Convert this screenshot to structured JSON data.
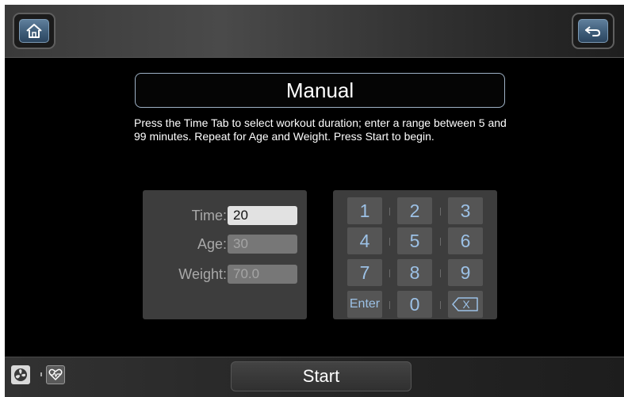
{
  "header": {
    "home_icon": "home-icon",
    "back_icon": "back-arrow-icon",
    "accent_color": "#4f7395"
  },
  "main": {
    "title": "Manual",
    "instructions": "Press the Time Tab to select workout duration; enter a range between 5 and 99 minutes. Repeat for Age and Weight. Press Start to begin."
  },
  "fields": [
    {
      "label": "Time:",
      "value": "20",
      "active": true
    },
    {
      "label": "Age:",
      "value": "30",
      "active": false
    },
    {
      "label": "Weight:",
      "value": "70.0",
      "active": false
    }
  ],
  "keypad": {
    "keys": [
      "1",
      "2",
      "3",
      "4",
      "5",
      "6",
      "7",
      "8",
      "9",
      "Enter",
      "0",
      "X"
    ],
    "key_color": "#9cc1e6"
  },
  "footer": {
    "start_label": "Start",
    "fan_icon": "fan-icon",
    "heart_rate_icon": "heart-rate-icon"
  }
}
